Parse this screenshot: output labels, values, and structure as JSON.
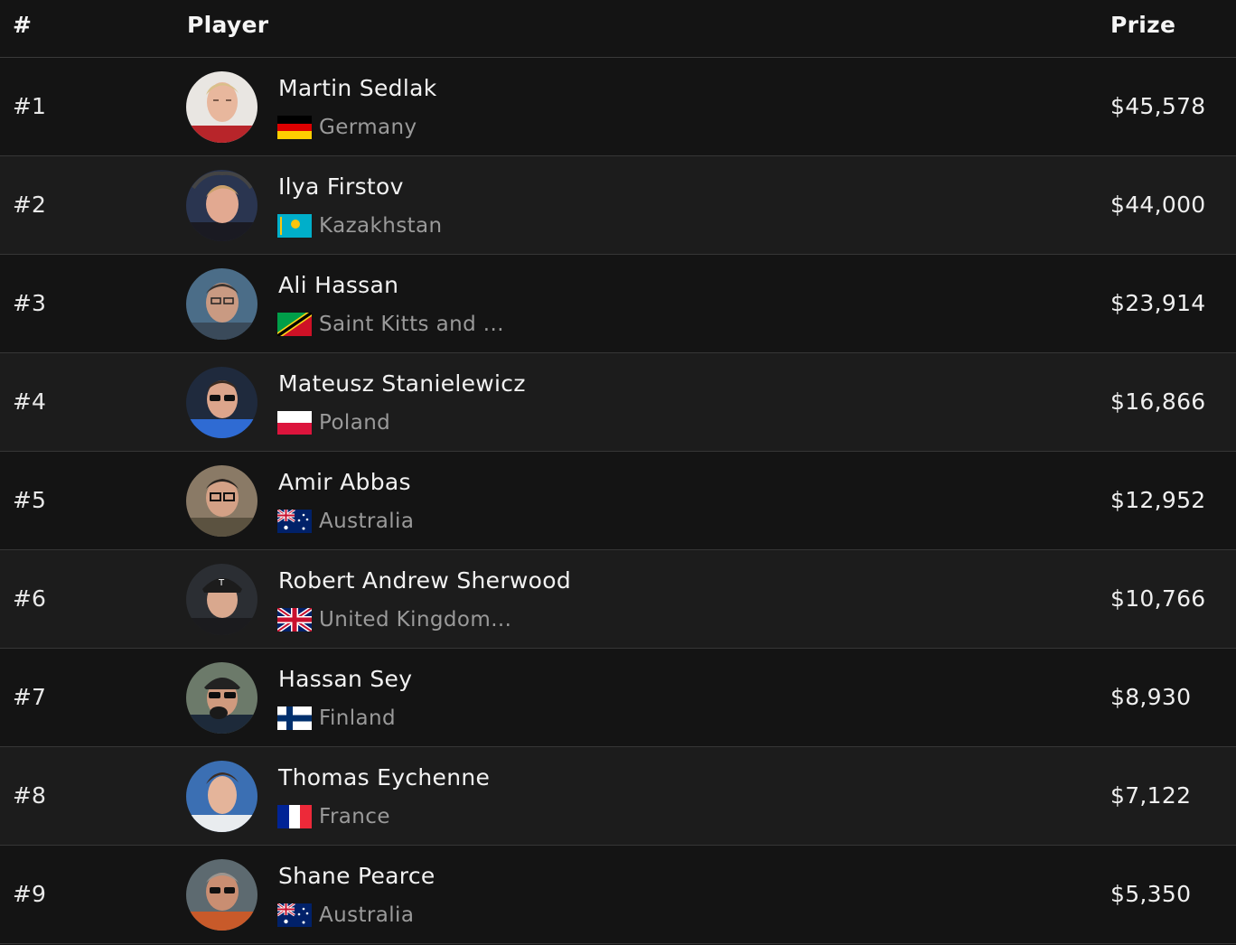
{
  "header": {
    "rank": "#",
    "player": "Player",
    "prize": "Prize"
  },
  "rows": [
    {
      "rank": "#1",
      "name": "Martin Sedlak",
      "country": "Germany",
      "prize": "$45,578"
    },
    {
      "rank": "#2",
      "name": "Ilya Firstov",
      "country": "Kazakhstan",
      "prize": "$44,000"
    },
    {
      "rank": "#3",
      "name": "Ali Hassan",
      "country": "Saint Kitts and ...",
      "prize": "$23,914"
    },
    {
      "rank": "#4",
      "name": "Mateusz Stanielewicz",
      "country": "Poland",
      "prize": "$16,866"
    },
    {
      "rank": "#5",
      "name": "Amir Abbas",
      "country": "Australia",
      "prize": "$12,952"
    },
    {
      "rank": "#6",
      "name": "Robert Andrew Sherwood",
      "country": "United Kingdom...",
      "prize": "$10,766"
    },
    {
      "rank": "#7",
      "name": "Hassan Sey",
      "country": "Finland",
      "prize": "$8,930"
    },
    {
      "rank": "#8",
      "name": "Thomas Eychenne",
      "country": "France",
      "prize": "$7,122"
    },
    {
      "rank": "#9",
      "name": "Shane Pearce",
      "country": "Australia",
      "prize": "$5,350"
    }
  ],
  "icons": {
    "flags": [
      "germany-flag-icon",
      "kazakhstan-flag-icon",
      "saint-kitts-flag-icon",
      "poland-flag-icon",
      "australia-flag-icon",
      "uk-flag-icon",
      "finland-flag-icon",
      "france-flag-icon",
      "australia-flag-icon"
    ]
  },
  "colors": {
    "background": "#141414",
    "row_alt": "#1c1c1c",
    "text": "#f2f2f2",
    "muted": "#9a9a9a",
    "divider": "#363636"
  }
}
